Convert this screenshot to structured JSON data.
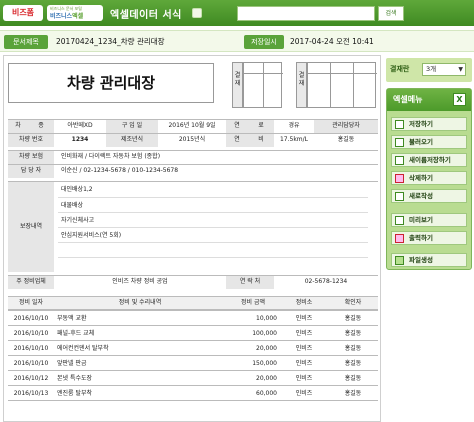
{
  "header": {
    "logo_bizpum": "비즈폼",
    "logo_tagline": "비즈니스 문서 포털",
    "logo_main_a": "비즈니스",
    "logo_main_b": "엑셀",
    "app_title": "엑셀데이터 서식",
    "search_value": "",
    "search_button": "검색"
  },
  "info": {
    "doc_no_label": "문서제목",
    "doc_no_value": "20170424_1234_차량 관리대장",
    "saved_label": "저장일시",
    "saved_value": "2017-04-24  오전 10:41"
  },
  "document": {
    "title": "차량 관리대장",
    "stamp1": {
      "label": "결재"
    },
    "stamp2": {
      "label": "결재"
    },
    "vehicle": {
      "row1": [
        "차",
        "종",
        "아반떼XD",
        "구 입 일",
        "2016년 10월 9일",
        "연",
        "료",
        "경유",
        "관리담당자"
      ],
      "row2": [
        "차량 번호",
        "1234",
        "제조년식",
        "2015년식",
        "연",
        "비",
        "17.5km/L",
        "홍길동"
      ],
      "insurance_label": "차량 보험",
      "insurance_value": "인비화재 / 다이렉트 자동차 보험 (종합)",
      "manager_label": "담 당 자",
      "manager_value": "이순신 / 02-1234-5678 / 010-1234-5678",
      "coverage_label": "보장내역",
      "coverage_items": [
        "대인배상1,2",
        "대물배상",
        "자기신체사고",
        "안심지원서비스(연 5회)",
        "",
        ""
      ],
      "shop_label": "주 정비업체",
      "shop_value": "인비즈 차량 정비 공업",
      "contact_label": "연 락 처",
      "contact_value": "02-5678-1234"
    },
    "history": {
      "headers": [
        "정비 일자",
        "정비 및 수리내역",
        "정비 금액",
        "정비소",
        "확인자"
      ],
      "rows": [
        [
          "2016/10/10",
          "부동액 교환",
          "10,000",
          "인비즈",
          "홍길동"
        ],
        [
          "2016/10/10",
          "패널-후드 교체",
          "100,000",
          "인비즈",
          "홍길동"
        ],
        [
          "2016/10/10",
          "에어컨컨덴서 탈부착",
          "20,000",
          "인비즈",
          "홍길동"
        ],
        [
          "2016/10/10",
          "앞판넬 판금",
          "150,000",
          "인비즈",
          "홍길동"
        ],
        [
          "2016/10/12",
          "본넷 특수도장",
          "20,000",
          "인비즈",
          "홍길동"
        ],
        [
          "2016/10/13",
          "엔진룸 탈부착",
          "60,000",
          "인비즈",
          "홍길동"
        ]
      ]
    }
  },
  "sidebar": {
    "approval_label": "결재란",
    "approval_value": "3개",
    "menu_title": "엑셀메뉴",
    "menu_items": [
      "저장하기",
      "불러오기",
      "새이름저장하기",
      "삭제하기",
      "새로작성",
      "미리보기",
      "출력하기",
      "파일생성"
    ]
  },
  "colors": {
    "brand_green": "#4c9a2a",
    "light_green": "#b9dc91"
  }
}
